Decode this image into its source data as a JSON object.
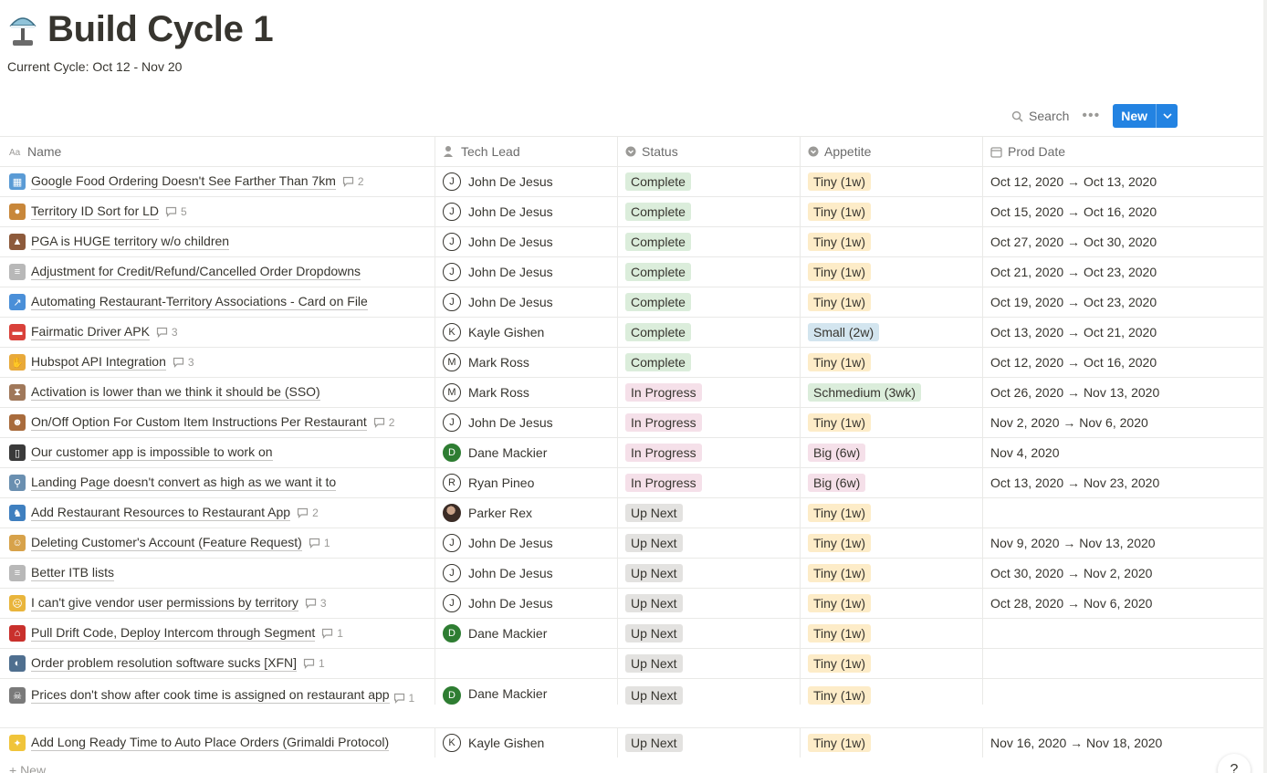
{
  "page": {
    "title": "Build Cycle 1",
    "icon": "desk-lamp-icon",
    "subtitle": "Current Cycle: Oct 12 - Nov 20"
  },
  "toolbar": {
    "search_label": "Search",
    "more_label": "•••",
    "new_label": "New"
  },
  "columns": [
    {
      "label": "Name",
      "icon": "text-property-icon"
    },
    {
      "label": "Tech Lead",
      "icon": "person-property-icon"
    },
    {
      "label": "Status",
      "icon": "select-property-icon"
    },
    {
      "label": "Appetite",
      "icon": "select-property-icon"
    },
    {
      "label": "Prod Date",
      "icon": "calendar-property-icon"
    }
  ],
  "colors": {
    "complete": "#dbeddb",
    "in_progress": "#f5e0e9",
    "up_next": "#e3e2e0",
    "tiny": "#fdecc8",
    "small": "#d3e5ef",
    "schmedium": "#dbeddb",
    "big": "#f5e0e9",
    "accent": "#2383e2"
  },
  "rows": [
    {
      "emoji": "map-icon",
      "emoji_color": "#5a9bd5",
      "name": "Google Food Ordering Doesn't See Farther Than 7km",
      "comments": "2",
      "lead": "John De Jesus",
      "lead_initial": "J",
      "avatar": "outline",
      "status": "Complete",
      "status_key": "complete",
      "appetite": "Tiny (1w)",
      "appetite_key": "tiny",
      "date": "Oct 12, 2020 → Oct 13, 2020"
    },
    {
      "emoji": "cookie-icon",
      "emoji_color": "#c8873a",
      "name": "Territory ID Sort for LD",
      "comments": "5",
      "lead": "John De Jesus",
      "lead_initial": "J",
      "avatar": "outline",
      "status": "Complete",
      "status_key": "complete",
      "appetite": "Tiny (1w)",
      "appetite_key": "tiny",
      "date": "Oct 15, 2020 → Oct 16, 2020"
    },
    {
      "emoji": "volcano-icon",
      "emoji_color": "#8d5a3b",
      "name": "PGA is HUGE territory w/o children",
      "comments": "",
      "lead": "John De Jesus",
      "lead_initial": "J",
      "avatar": "outline",
      "status": "Complete",
      "status_key": "complete",
      "appetite": "Tiny (1w)",
      "appetite_key": "tiny",
      "date": "Oct 27, 2020 → Oct 30, 2020"
    },
    {
      "emoji": "receipt-icon",
      "emoji_color": "#b8b8b8",
      "name": "Adjustment for Credit/Refund/Cancelled Order Dropdowns",
      "comments": "",
      "lead": "John De Jesus",
      "lead_initial": "J",
      "avatar": "outline",
      "status": "Complete",
      "status_key": "complete",
      "appetite": "Tiny (1w)",
      "appetite_key": "tiny",
      "date": "Oct 21, 2020 → Oct 23, 2020"
    },
    {
      "emoji": "chart-icon",
      "emoji_color": "#4a8fd8",
      "name": "Automating Restaurant-Territory Associations - Card on File",
      "comments": "",
      "lead": "John De Jesus",
      "lead_initial": "J",
      "avatar": "outline",
      "status": "Complete",
      "status_key": "complete",
      "appetite": "Tiny (1w)",
      "appetite_key": "tiny",
      "date": "Oct 19, 2020 → Oct 23, 2020"
    },
    {
      "emoji": "car-icon",
      "emoji_color": "#d9413a",
      "name": "Fairmatic Driver APK",
      "comments": "3",
      "lead": "Kayle Gishen",
      "lead_initial": "K",
      "avatar": "outline",
      "status": "Complete",
      "status_key": "complete",
      "appetite": "Small (2w)",
      "appetite_key": "small",
      "date": "Oct 13, 2020 → Oct 21, 2020"
    },
    {
      "emoji": "handshake-icon",
      "emoji_color": "#e8a93a",
      "name": "Hubspot API Integration",
      "comments": "3",
      "lead": "Mark Ross",
      "lead_initial": "M",
      "avatar": "outline",
      "status": "Complete",
      "status_key": "complete",
      "appetite": "Tiny (1w)",
      "appetite_key": "tiny",
      "date": "Oct 12, 2020 → Oct 16, 2020"
    },
    {
      "emoji": "hourglass-icon",
      "emoji_color": "#a0785a",
      "name": "Activation is lower than we think it should be (SSO)",
      "comments": "",
      "lead": "Mark Ross",
      "lead_initial": "M",
      "avatar": "outline",
      "status": "In Progress",
      "status_key": "in_progress",
      "appetite": "Schmedium (3wk)",
      "appetite_key": "schmedium",
      "date": "Oct 26, 2020 → Nov 13, 2020"
    },
    {
      "emoji": "monkey-icon",
      "emoji_color": "#a86b3c",
      "name": "On/Off Option For Custom Item Instructions Per Restaurant",
      "comments": "2",
      "lead": "John De Jesus",
      "lead_initial": "J",
      "avatar": "outline",
      "status": "In Progress",
      "status_key": "in_progress",
      "appetite": "Tiny (1w)",
      "appetite_key": "tiny",
      "date": "Nov 2, 2020 → Nov 6, 2020"
    },
    {
      "emoji": "phone-icon",
      "emoji_color": "#3a3a3a",
      "name": "Our customer app is impossible to work on",
      "comments": "",
      "lead": "Dane Mackier",
      "lead_initial": "D",
      "avatar": "green",
      "status": "In Progress",
      "status_key": "in_progress",
      "appetite": "Big (6w)",
      "appetite_key": "big",
      "date": "Nov 4, 2020"
    },
    {
      "emoji": "magnifier-icon",
      "emoji_color": "#6a8fb0",
      "name": "Landing Page doesn't convert as high as we want it to",
      "comments": "",
      "lead": "Ryan Pineo",
      "lead_initial": "R",
      "avatar": "outline",
      "status": "In Progress",
      "status_key": "in_progress",
      "appetite": "Big (6w)",
      "appetite_key": "big",
      "date": "Oct 13, 2020 → Nov 23, 2020"
    },
    {
      "emoji": "dinosaur-icon",
      "emoji_color": "#3f7fbf",
      "name": "Add Restaurant Resources to Restaurant App",
      "comments": "2",
      "lead": "Parker Rex",
      "lead_initial": "",
      "avatar": "photo",
      "status": "Up Next",
      "status_key": "up_next",
      "appetite": "Tiny (1w)",
      "appetite_key": "tiny",
      "date": ""
    },
    {
      "emoji": "person-icon",
      "emoji_color": "#d7a24a",
      "name": "Deleting Customer's Account (Feature Request)",
      "comments": "1",
      "lead": "John De Jesus",
      "lead_initial": "J",
      "avatar": "outline",
      "status": "Up Next",
      "status_key": "up_next",
      "appetite": "Tiny (1w)",
      "appetite_key": "tiny",
      "date": "Nov 9, 2020 → Nov 13, 2020"
    },
    {
      "emoji": "receipt-icon",
      "emoji_color": "#b8b8b8",
      "name": "Better ITB lists",
      "comments": "",
      "lead": "John De Jesus",
      "lead_initial": "J",
      "avatar": "outline",
      "status": "Up Next",
      "status_key": "up_next",
      "appetite": "Tiny (1w)",
      "appetite_key": "tiny",
      "date": "Oct 30, 2020 → Nov 2, 2020"
    },
    {
      "emoji": "sad-face-icon",
      "emoji_color": "#e9b53c",
      "name": "I can't give vendor user permissions by territory",
      "comments": "3",
      "lead": "John De Jesus",
      "lead_initial": "J",
      "avatar": "outline",
      "status": "Up Next",
      "status_key": "up_next",
      "appetite": "Tiny (1w)",
      "appetite_key": "tiny",
      "date": "Oct 28, 2020 → Nov 6, 2020"
    },
    {
      "emoji": "bank-icon",
      "emoji_color": "#c9302c",
      "name": "Pull Drift Code, Deploy Intercom through Segment",
      "comments": "1",
      "lead": "Dane Mackier",
      "lead_initial": "D",
      "avatar": "green",
      "status": "Up Next",
      "status_key": "up_next",
      "appetite": "Tiny (1w)",
      "appetite_key": "tiny",
      "date": ""
    },
    {
      "emoji": "speaking-head-icon",
      "emoji_color": "#4f6f8f",
      "name": "Order problem resolution software sucks [XFN]",
      "comments": "1",
      "lead": "",
      "lead_initial": "",
      "avatar": "none",
      "status": "Up Next",
      "status_key": "up_next",
      "appetite": "Tiny (1w)",
      "appetite_key": "tiny",
      "date": ""
    },
    {
      "emoji": "skull-icon",
      "emoji_color": "#7a7a7a",
      "name": "Prices don't show after cook time is assigned on restaurant app",
      "comments": "1",
      "lead": "Dane Mackier",
      "lead_initial": "D",
      "avatar": "green",
      "status": "Up Next",
      "status_key": "up_next",
      "appetite": "Tiny (1w)",
      "appetite_key": "tiny",
      "date": "",
      "tall": true
    },
    {
      "emoji": "lightbulb-icon",
      "emoji_color": "#f0c43a",
      "name": "Add Long Ready Time to Auto Place Orders (Grimaldi Protocol)",
      "comments": "",
      "lead": "Kayle Gishen",
      "lead_initial": "K",
      "avatar": "outline",
      "status": "Up Next",
      "status_key": "up_next",
      "appetite": "Tiny (1w)",
      "appetite_key": "tiny",
      "date": "Nov 16, 2020 → Nov 18, 2020"
    }
  ],
  "footer": {
    "new_row_label": "+ New",
    "help_label": "?"
  }
}
